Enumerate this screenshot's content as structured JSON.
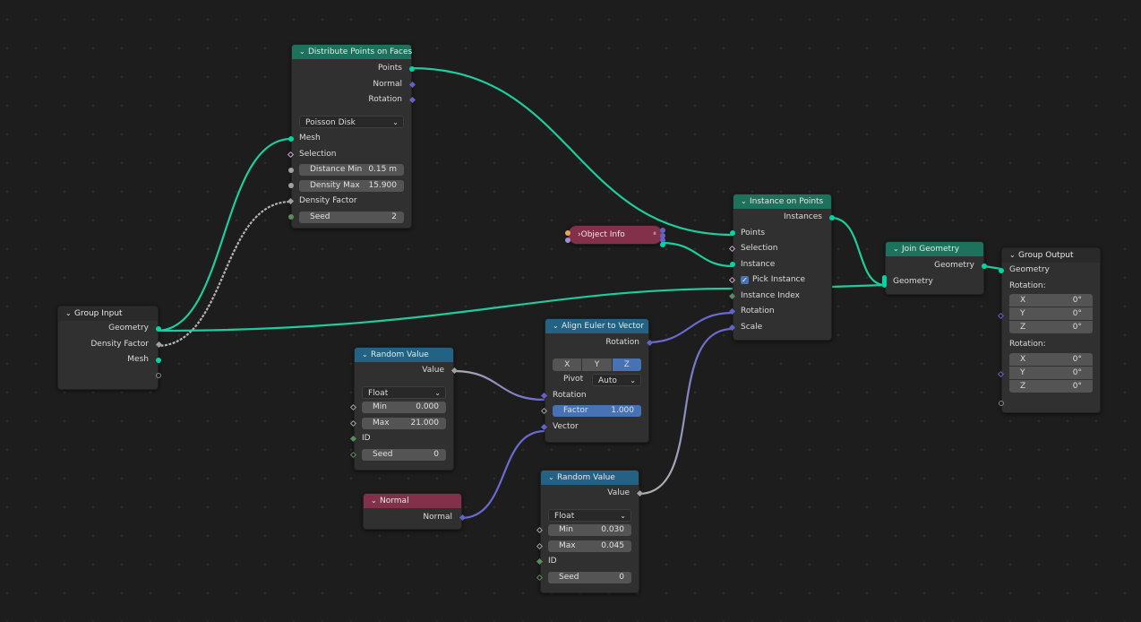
{
  "editor": "Geometry Nodes Editor",
  "colors": {
    "geometry_socket": "#00d6a3",
    "vector_socket": "#6363c7",
    "float_socket": "#a1a1a1",
    "integer_socket": "#598c5c",
    "boolean_socket": "#cca6d6",
    "geometry_header": "#1d725e",
    "utility_header": "#246283",
    "input_header": "#83314a",
    "selected_field": "#4772b3"
  },
  "nodes": {
    "group_input": {
      "title": "Group Input",
      "outputs": [
        "Geometry",
        "Density Factor",
        "Mesh"
      ]
    },
    "distribute": {
      "title": "Distribute Points on Faces",
      "outputs": [
        "Points",
        "Normal",
        "Rotation"
      ],
      "mode": "Poisson Disk",
      "inputs": {
        "mesh": "Mesh",
        "selection": "Selection",
        "distance_min_label": "Distance Min",
        "distance_min": "0.15 m",
        "density_max_label": "Density Max",
        "density_max": "15.900",
        "density_factor": "Density Factor",
        "seed_label": "Seed",
        "seed": "2"
      }
    },
    "object_info": {
      "title": "Object Info"
    },
    "instance_on_points": {
      "title": "Instance on Points",
      "output": "Instances",
      "inputs": [
        "Points",
        "Selection",
        "Instance",
        "Pick Instance",
        "Instance Index",
        "Rotation",
        "Scale"
      ],
      "pick_instance_checked": true
    },
    "join_geometry": {
      "title": "Join Geometry",
      "output": "Geometry",
      "input": "Geometry"
    },
    "group_output": {
      "title": "Group Output",
      "input": "Geometry",
      "rotation1": {
        "label": "Rotation:",
        "x": "0°",
        "y": "0°",
        "z": "0°"
      },
      "rotation2": {
        "label": "Rotation:",
        "x": "0°",
        "y": "0°",
        "z": "0°"
      },
      "axes": [
        "X",
        "Y",
        "Z"
      ]
    },
    "random_value_1": {
      "title": "Random Value",
      "output": "Value",
      "type": "Float",
      "min_label": "Min",
      "min": "0.000",
      "max_label": "Max",
      "max": "21.000",
      "id_label": "ID",
      "seed_label": "Seed",
      "seed": "0"
    },
    "align_euler": {
      "title": "Align Euler to Vector",
      "output": "Rotation",
      "axes": [
        "X",
        "Y",
        "Z"
      ],
      "selected_axis": "Z",
      "pivot_label": "Pivot",
      "pivot": "Auto",
      "rotation_label": "Rotation",
      "factor_label": "Factor",
      "factor": "1.000",
      "vector_label": "Vector"
    },
    "normal": {
      "title": "Normal",
      "output": "Normal"
    },
    "random_value_2": {
      "title": "Random Value",
      "output": "Value",
      "type": "Float",
      "min_label": "Min",
      "min": "0.030",
      "max_label": "Max",
      "max": "0.045",
      "id_label": "ID",
      "seed_label": "Seed",
      "seed": "0"
    }
  }
}
